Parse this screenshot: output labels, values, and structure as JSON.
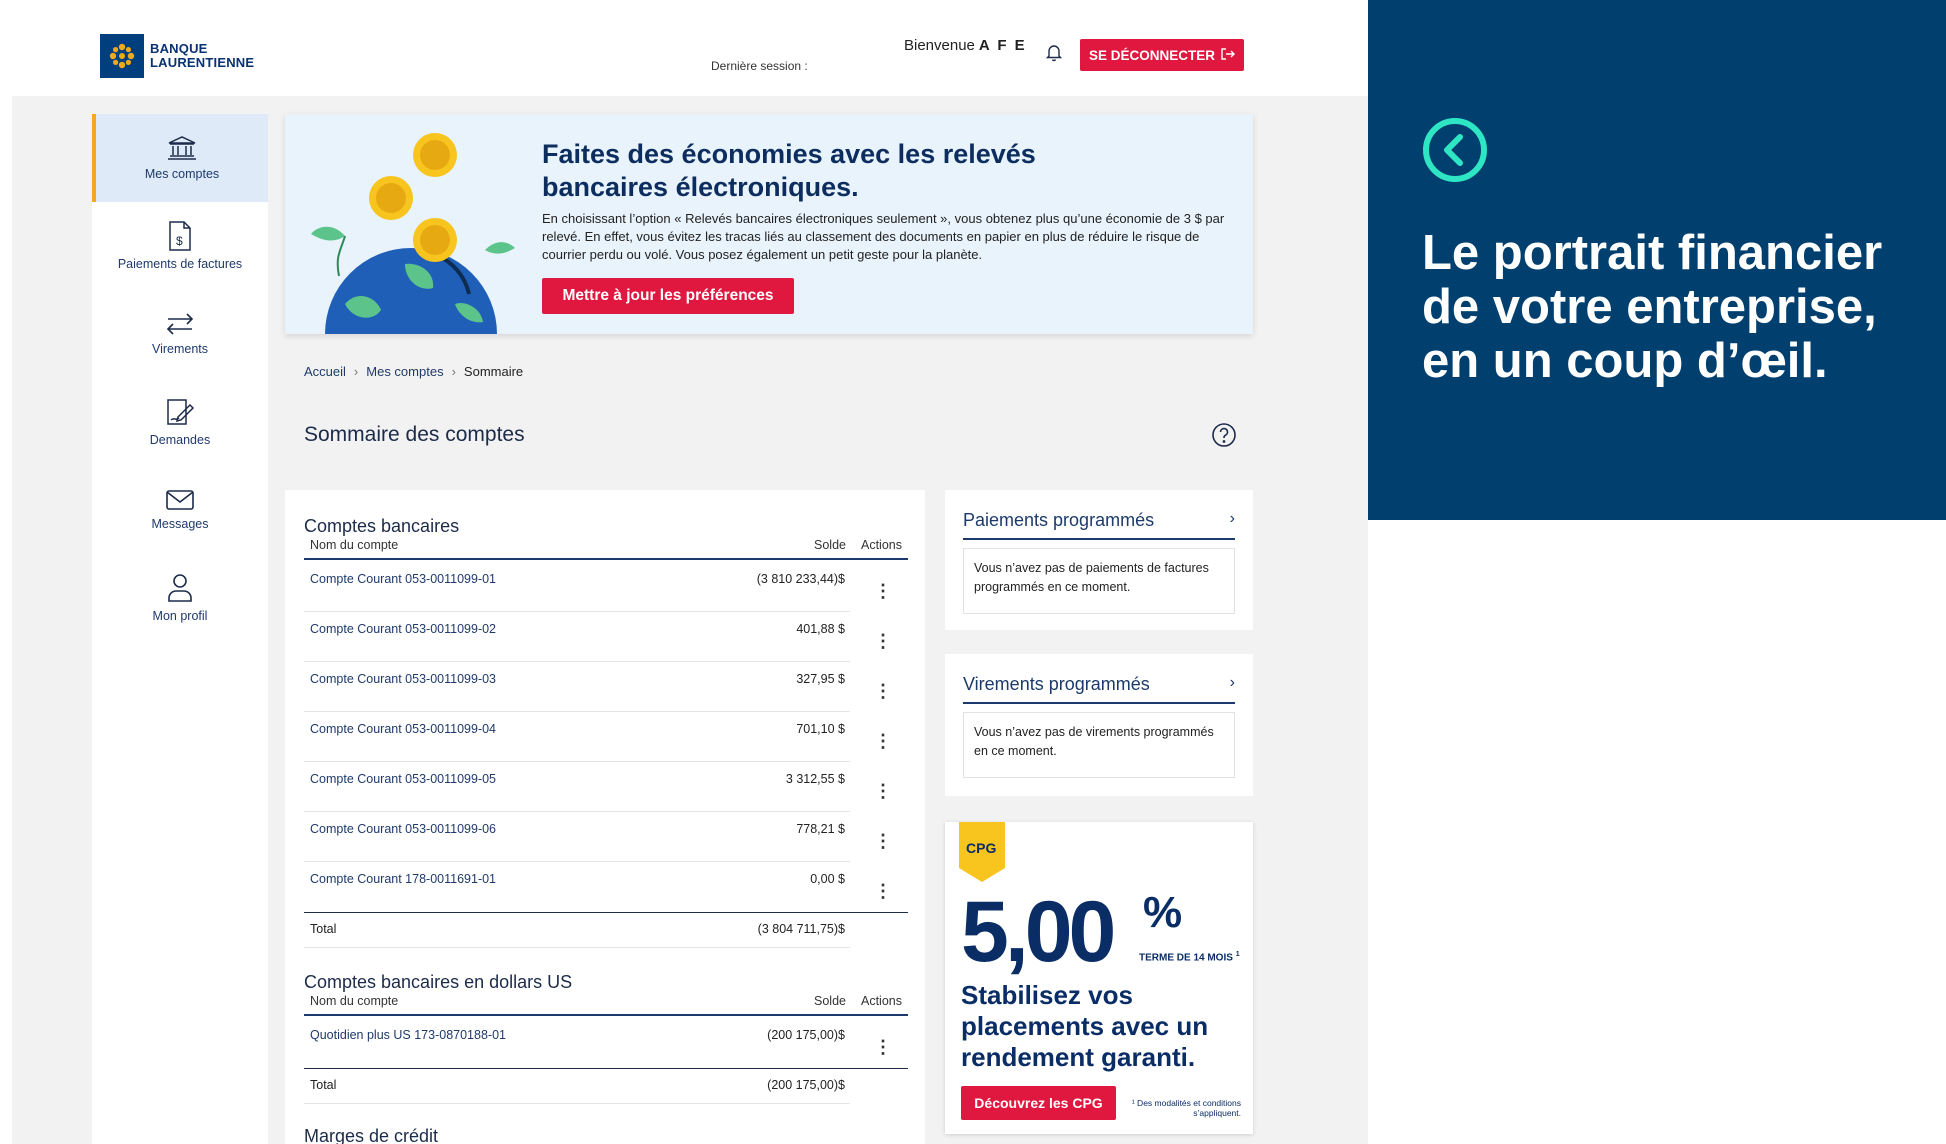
{
  "header": {
    "brand_line1": "BANQUE",
    "brand_line2": "LAURENTIENNE",
    "welcome_label": "Bienvenue",
    "user_initials": "A F E",
    "last_session_label": "Dernière session :",
    "logout_label": "SE DÉCONNECTER"
  },
  "sidebar": {
    "items": [
      {
        "label": "Mes comptes",
        "icon": "bank-icon",
        "active": true
      },
      {
        "label": "Paiements de factures",
        "icon": "bill-icon"
      },
      {
        "label": "Virements",
        "icon": "transfer-arrows-icon"
      },
      {
        "label": "Demandes",
        "icon": "request-form-icon"
      },
      {
        "label": "Messages",
        "icon": "envelope-icon"
      },
      {
        "label": "Mon profil",
        "icon": "user-icon"
      }
    ]
  },
  "banner": {
    "title": "Faites des économies avec les relevés bancaires électroniques.",
    "text": "En choisissant l’option « Relevés bancaires électroniques seulement », vous obtenez plus qu’une économie de 3 $ par relevé. En effet, vous évitez les tracas liés au classement des documents en papier en plus de réduire le risque de courrier perdu ou volé. Vous posez également un petit geste pour la planète.",
    "button_label": "Mettre à jour les préférences"
  },
  "breadcrumb": [
    "Accueil",
    "Mes comptes",
    "Sommaire"
  ],
  "page_title": "Sommaire des comptes",
  "bank_accounts": {
    "title": "Comptes bancaires",
    "columns": [
      "Nom du compte",
      "Solde",
      "Actions"
    ],
    "rows": [
      {
        "name": "Compte Courant 053-0011099-01",
        "balance": "(3 810 233,44)$"
      },
      {
        "name": "Compte Courant 053-0011099-02",
        "balance": "401,88 $"
      },
      {
        "name": "Compte Courant 053-0011099-03",
        "balance": "327,95 $"
      },
      {
        "name": "Compte Courant 053-0011099-04",
        "balance": "701,10 $"
      },
      {
        "name": "Compte Courant 053-0011099-05",
        "balance": "3 312,55 $"
      },
      {
        "name": "Compte Courant 053-0011099-06",
        "balance": "778,21 $"
      },
      {
        "name": "Compte Courant 178-0011691-01",
        "balance": "0,00 $"
      }
    ],
    "total_label": "Total",
    "total": "(3 804 711,75)$"
  },
  "us_accounts": {
    "title": "Comptes bancaires en dollars US",
    "columns": [
      "Nom du compte",
      "Solde",
      "Actions"
    ],
    "rows": [
      {
        "name": "Quotidien plus US 173-0870188-01",
        "balance": "(200 175,00)$"
      }
    ],
    "total_label": "Total",
    "total": "(200 175,00)$"
  },
  "credit_lines": {
    "title": "Marges de crédit"
  },
  "scheduled_payments": {
    "title": "Paiements programmés",
    "message": "Vous n’avez pas de paiements de factures programmés en ce moment."
  },
  "scheduled_transfers": {
    "title": "Virements programmés",
    "message": "Vous n’avez pas de virements programmés en ce moment."
  },
  "ad": {
    "tag": "CPG",
    "rate": "5,00",
    "percent": "%",
    "term": "TERME DE 14 MOIS",
    "term_note": "1",
    "headline": "Stabilisez vos placements avec un rendement garanti.",
    "button_label": "Découvrez les CPG",
    "footnote": "¹ Des modalités et conditions s’appliquent."
  },
  "promo": {
    "text": "Le portrait financier de votre entreprise, en un coup d’œil."
  },
  "colors": {
    "brand_navy": "#003f6e",
    "accent_red": "#e0173f",
    "accent_teal": "#2ee6c3",
    "active_nav_bg": "#deeaf7",
    "active_nav_border": "#f4a81b"
  }
}
